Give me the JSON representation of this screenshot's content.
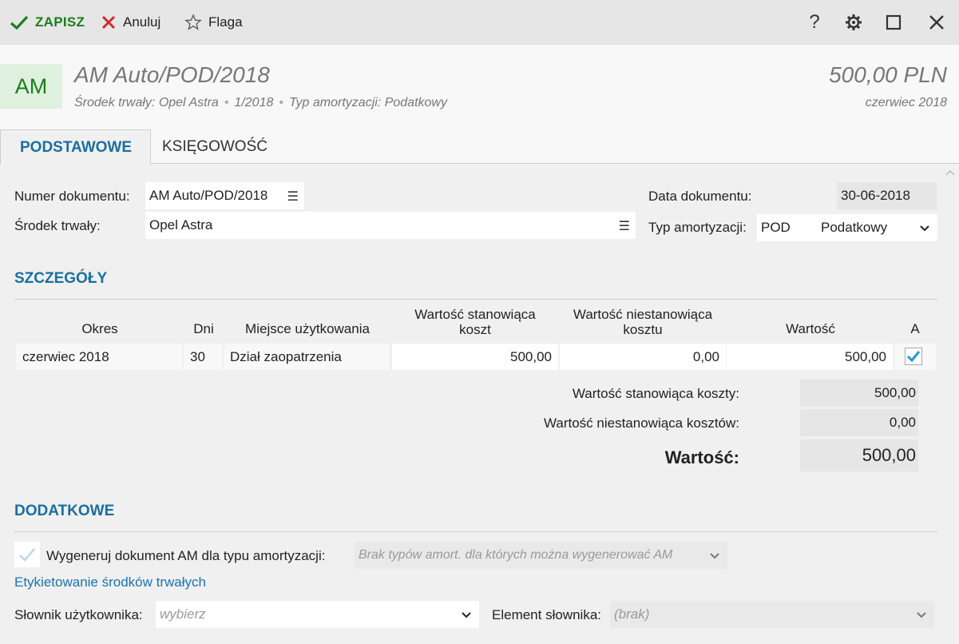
{
  "toolbar": {
    "save_label": "ZAPISZ",
    "cancel_label": "Anuluj",
    "flag_label": "Flaga",
    "help_label": "?"
  },
  "header": {
    "icon_text": "AM",
    "title": "AM Auto/POD/2018",
    "sub_asset": "Środek trwały: Opel Astra",
    "sub_number": "1/2018",
    "sub_type": "Typ amortyzacji: Podatkowy",
    "amount": "500,00 PLN",
    "period": "czerwiec 2018"
  },
  "tabs": [
    {
      "label": "PODSTAWOWE",
      "active": true
    },
    {
      "label": "KSIĘGOWOŚĆ",
      "active": false
    }
  ],
  "form": {
    "doc_number_label": "Numer dokumentu:",
    "doc_number_value": "AM Auto/POD/2018",
    "asset_label": "Środek trwały:",
    "asset_value": "Opel Astra",
    "doc_date_label": "Data dokumentu:",
    "doc_date_value": "30-06-2018",
    "amort_type_label": "Typ amortyzacji:",
    "amort_type_code": "POD",
    "amort_type_name": "Podatkowy"
  },
  "details": {
    "title": "SZCZEGÓŁY",
    "columns": [
      "Okres",
      "Dni",
      "Miejsce użytkowania",
      "Wartość stanowiąca koszt",
      "Wartość niestanowiąca kosztu",
      "Wartość",
      "A"
    ],
    "col_cost_line1": "Wartość stanowiąca",
    "col_cost_line2": "koszt",
    "col_noncost_line1": "Wartość niestanowiąca",
    "col_noncost_line2": "kosztu",
    "rows": [
      {
        "period": "czerwiec 2018",
        "days": "30",
        "location": "Dział zaopatrzenia",
        "cost": "500,00",
        "noncost": "0,00",
        "value": "500,00",
        "a": true
      }
    ],
    "sum_cost_label": "Wartość stanowiąca koszty:",
    "sum_cost_value": "500,00",
    "sum_noncost_label": "Wartość niestanowiąca kosztów:",
    "sum_noncost_value": "0,00",
    "sum_total_label": "Wartość:",
    "sum_total_value": "500,00"
  },
  "additional": {
    "title": "DODATKOWE",
    "generate_label": "Wygeneruj dokument AM dla typu amortyzacji:",
    "generate_placeholder": "Brak typów amort. dla których można wygenerować AM",
    "labels_link": "Etykietowanie środków trwałych",
    "dict_label": "Słownik użytkownika:",
    "dict_placeholder": "wybierz",
    "dict_element_label": "Element słownika:",
    "dict_element_placeholder": "(brak)"
  },
  "colors": {
    "accent": "#1a6ea0",
    "save_green": "#1b7d1b",
    "cancel_red": "#d42a2a",
    "check_blue": "#1a9ad6"
  }
}
